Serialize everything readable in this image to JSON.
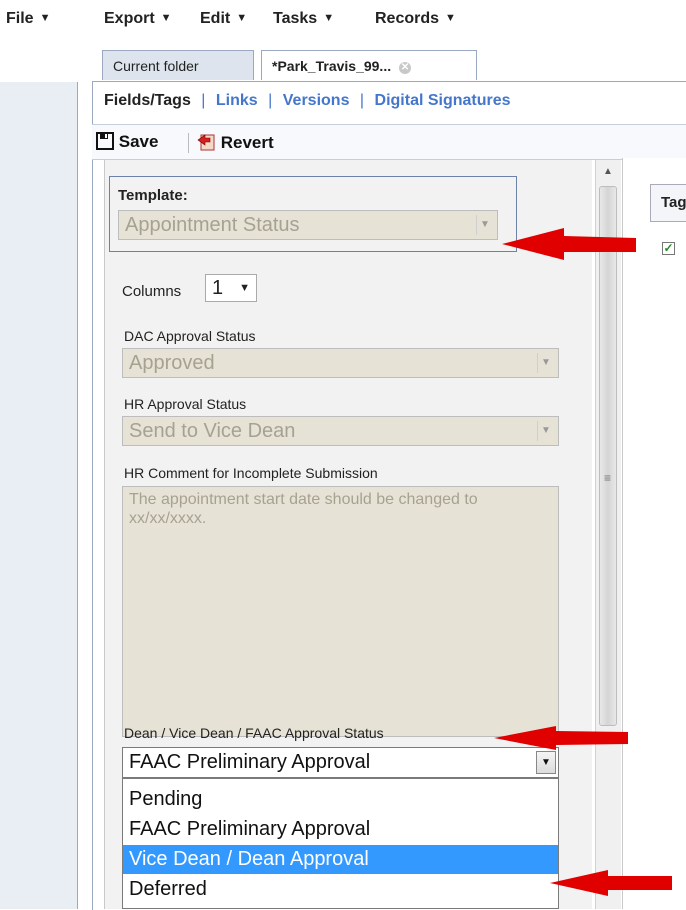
{
  "menubar": {
    "items": [
      {
        "label": "File"
      },
      {
        "label": "Export"
      },
      {
        "label": "Edit"
      },
      {
        "label": "Tasks"
      },
      {
        "label": "Records"
      }
    ]
  },
  "tabs": [
    {
      "label": "Current folder"
    },
    {
      "label": "*Park_Travis_99..."
    }
  ],
  "subnav": {
    "current": "Fields/Tags",
    "links": [
      "Links",
      "Versions",
      "Digital Signatures"
    ],
    "separator": "|"
  },
  "toolbar": {
    "save_label": "Save",
    "revert_label": "Revert"
  },
  "form": {
    "template_label": "Template:",
    "template_value": "Appointment Status",
    "columns_label": "Columns",
    "columns_value": "1",
    "dac_label": "DAC Approval Status",
    "dac_value": "Approved",
    "hr_label": "HR Approval Status",
    "hr_value": "Send to Vice Dean",
    "hr_comment_label": "HR Comment for Incomplete Submission",
    "hr_comment_value": "The appointment start date should be changed to xx/xx/xxxx.",
    "dean_label": "Dean / Vice Dean / FAAC Approval Status",
    "dean_value": "FAAC Preliminary Approval",
    "dean_options": [
      {
        "label": "Pending",
        "selected": false
      },
      {
        "label": "FAAC Preliminary Approval",
        "selected": false
      },
      {
        "label": "Vice Dean / Dean Approval",
        "selected": true
      },
      {
        "label": "Deferred",
        "selected": false
      }
    ]
  },
  "right_panel": {
    "tag_header": "Tags",
    "checkbox_checked": true
  },
  "colors": {
    "link": "#4477cc",
    "selection": "#3399ff",
    "annotation_arrow": "#e00000",
    "disabled_field": "#e6e2d6"
  }
}
